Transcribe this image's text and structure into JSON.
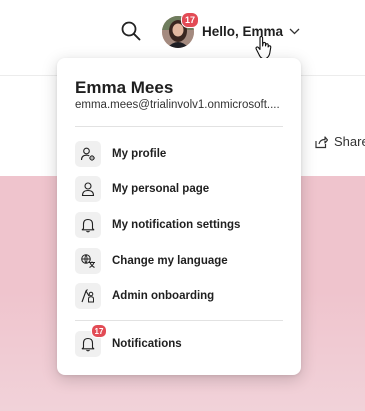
{
  "header": {
    "greeting": "Hello, Emma",
    "avatar_badge": "17",
    "share_label": "Share"
  },
  "menu": {
    "user_name": "Emma Mees",
    "user_email": "emma.mees@trialinvolv1.onmicrosoft....",
    "items": [
      {
        "label": "My profile",
        "icon": "profile-settings-icon"
      },
      {
        "label": "My personal page",
        "icon": "person-icon"
      },
      {
        "label": "My notification settings",
        "icon": "bell-icon"
      },
      {
        "label": "Change my language",
        "icon": "language-icon"
      },
      {
        "label": "Admin onboarding",
        "icon": "admin-onboarding-icon"
      }
    ],
    "notifications": {
      "label": "Notifications",
      "badge": "17",
      "icon": "bell-icon"
    }
  },
  "colors": {
    "badge": "#e24b55",
    "background_pink": "#efc4cd",
    "icon_tile": "#f0f0f0"
  }
}
